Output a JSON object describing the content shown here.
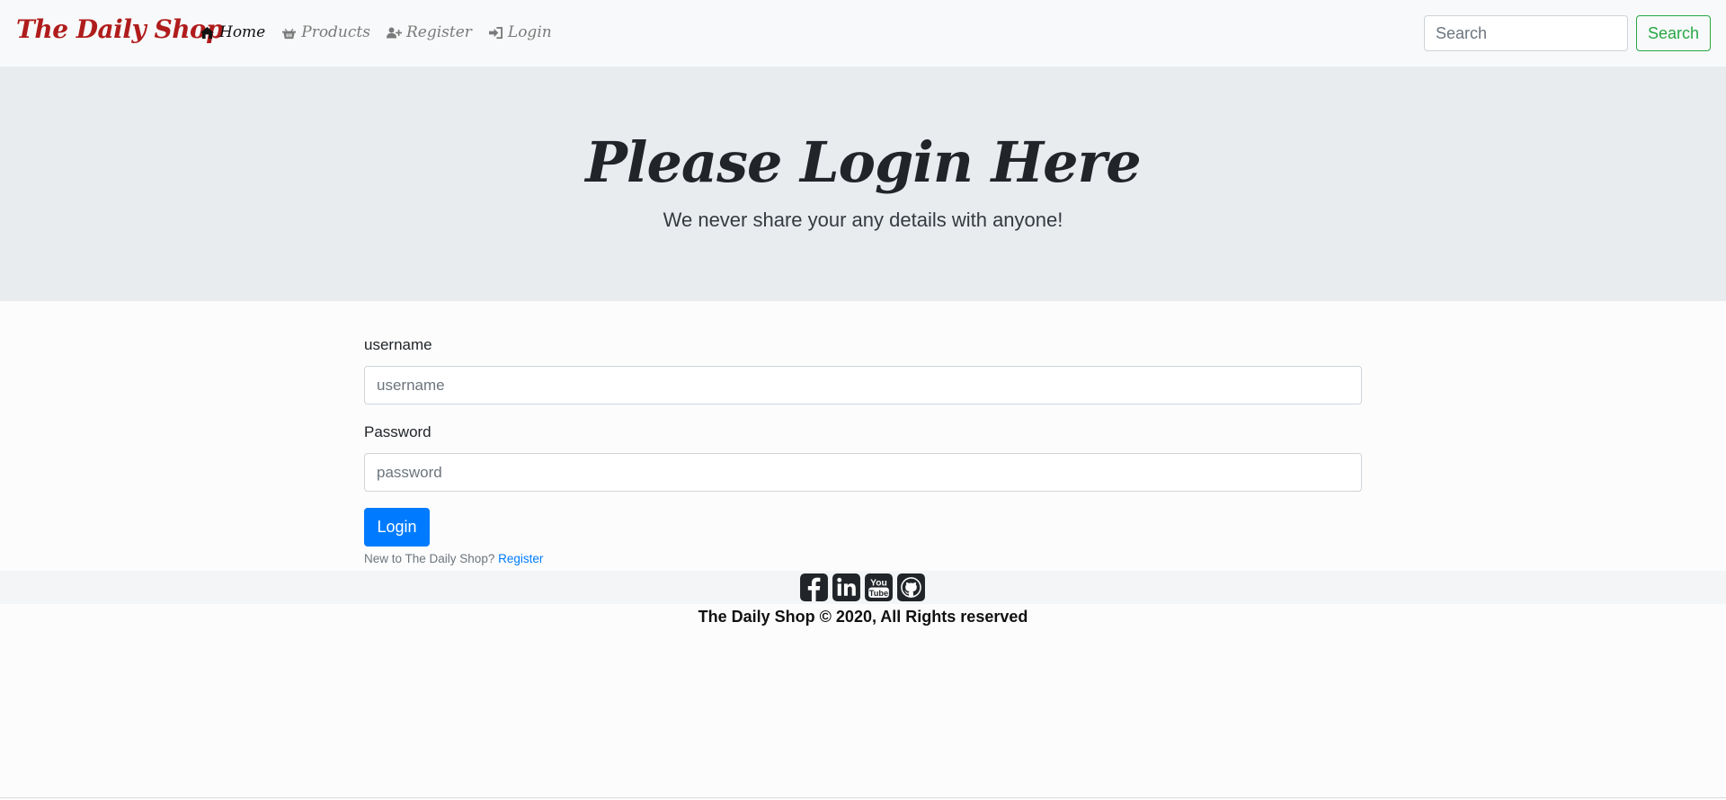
{
  "navbar": {
    "brand": "The Daily Shop",
    "links": [
      {
        "label": "Home",
        "icon": "home-icon",
        "active": true
      },
      {
        "label": "Products",
        "icon": "basket-icon",
        "active": false
      },
      {
        "label": "Register",
        "icon": "user-plus-icon",
        "active": false
      },
      {
        "label": "Login",
        "icon": "sign-in-icon",
        "active": false
      }
    ],
    "search": {
      "placeholder": "Search",
      "button_label": "Search"
    }
  },
  "jumbotron": {
    "title": "Please Login Here",
    "lead": "We never share your any details with anyone!"
  },
  "form": {
    "username_label": "username",
    "username_placeholder": "username",
    "password_label": "Password",
    "password_placeholder": "password",
    "login_button": "Login",
    "register_prompt": "New to The Daily Shop?",
    "register_link": "Register"
  },
  "footer": {
    "social": [
      "facebook-icon",
      "linkedin-icon",
      "youtube-icon",
      "github-icon"
    ],
    "copyright": "The Daily Shop © 2020, All Rights reserved"
  },
  "colors": {
    "brand": "#b01c1c",
    "primary": "#007bff",
    "success": "#28a745",
    "jumbotron_bg": "#e9ecef",
    "navbar_bg": "#f8f9fa"
  }
}
